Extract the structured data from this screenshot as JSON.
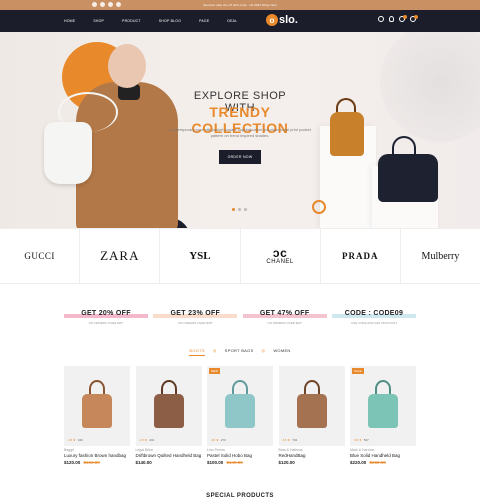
{
  "topbar": {
    "promo": "Summer sale the off with code - off 2024 Shop Now",
    "social_icons": [
      "facebook-icon",
      "twitter-icon",
      "instagram-icon",
      "pinterest-icon"
    ]
  },
  "nav": {
    "menu": [
      "HOME",
      "SHOP",
      "PRODUCT",
      "SHOP BLOG",
      "PAGE",
      "DEAL"
    ],
    "logo_letter": "o",
    "logo_text": "slo.",
    "icons": [
      "search-icon",
      "user-icon",
      "heart-icon",
      "cart-icon"
    ]
  },
  "hero": {
    "subtitle": "EXPLORE SHOP WITH",
    "title": "TRENDY COLLECTION",
    "description": "Contemporary pure silk pocket square sophistication luxurious coral print pocket pattern on trend inspired shades.",
    "button": "ORDER NOW"
  },
  "brands": [
    "GUCCI",
    "ZARA",
    "YSL",
    "CHANEL",
    "PRADA",
    "Mulberry"
  ],
  "offers": [
    {
      "title": "GET 20% OFF",
      "sub": "ON ORDERS OVER $39*",
      "color": "#f3b8c9"
    },
    {
      "title": "GET 23% OFF",
      "sub": "ON ORDERS OVER $39*",
      "color": "#f9dccb"
    },
    {
      "title": "GET 47% OFF",
      "sub": "ON ORDERS OVER $29*",
      "color": "#f3c3cf"
    },
    {
      "title": "CODE : CODE09",
      "sub": "USE CODE AND GET DISCOUNT",
      "color": "#cfe7ef"
    }
  ],
  "tabs": [
    "BOOTS",
    "SPORT BAGS",
    "WOMEN"
  ],
  "products": [
    {
      "tag": "",
      "rating": "4.5 ★",
      "reviews": "349",
      "brand": "Baggit",
      "name": "Luxury fashion Brown handbag",
      "price": "$120.00",
      "old_price": "$150.00",
      "color": "#c6875a",
      "handle": "#8a5430"
    },
    {
      "tag": "",
      "rating": "4.5 ★",
      "reviews": "243",
      "brand": "Legal Bribe",
      "name": "Driftbrown Quilted Handheld Bag",
      "price": "$140.00",
      "old_price": "",
      "color": "#8b5e45",
      "handle": "#5d3a26"
    },
    {
      "tag": "NEW",
      "rating": "4.5 ★",
      "reviews": "273",
      "brand": "Lino Perros",
      "name": "Pastel Solid Hobo Bag",
      "price": "$100.00",
      "old_price": "$140.00",
      "color": "#8fc7c8",
      "handle": "#5d9b9c"
    },
    {
      "tag": "",
      "rating": "4.5 ★",
      "reviews": "734",
      "brand": "Bata & Hallmas",
      "name": "RedHandBag",
      "price": "$120.00",
      "old_price": "",
      "color": "#a47250",
      "handle": "#6e4528"
    },
    {
      "tag": "SALE",
      "rating": "4.5 ★",
      "reviews": "537",
      "brand": "Mark & Harmon",
      "name": "Blue Solid Handheld Bag",
      "price": "$220.00",
      "old_price": "$230.00",
      "color": "#7cc4b6",
      "handle": "#4d8f82"
    }
  ],
  "special": "SPECIAL PRODUCTS"
}
